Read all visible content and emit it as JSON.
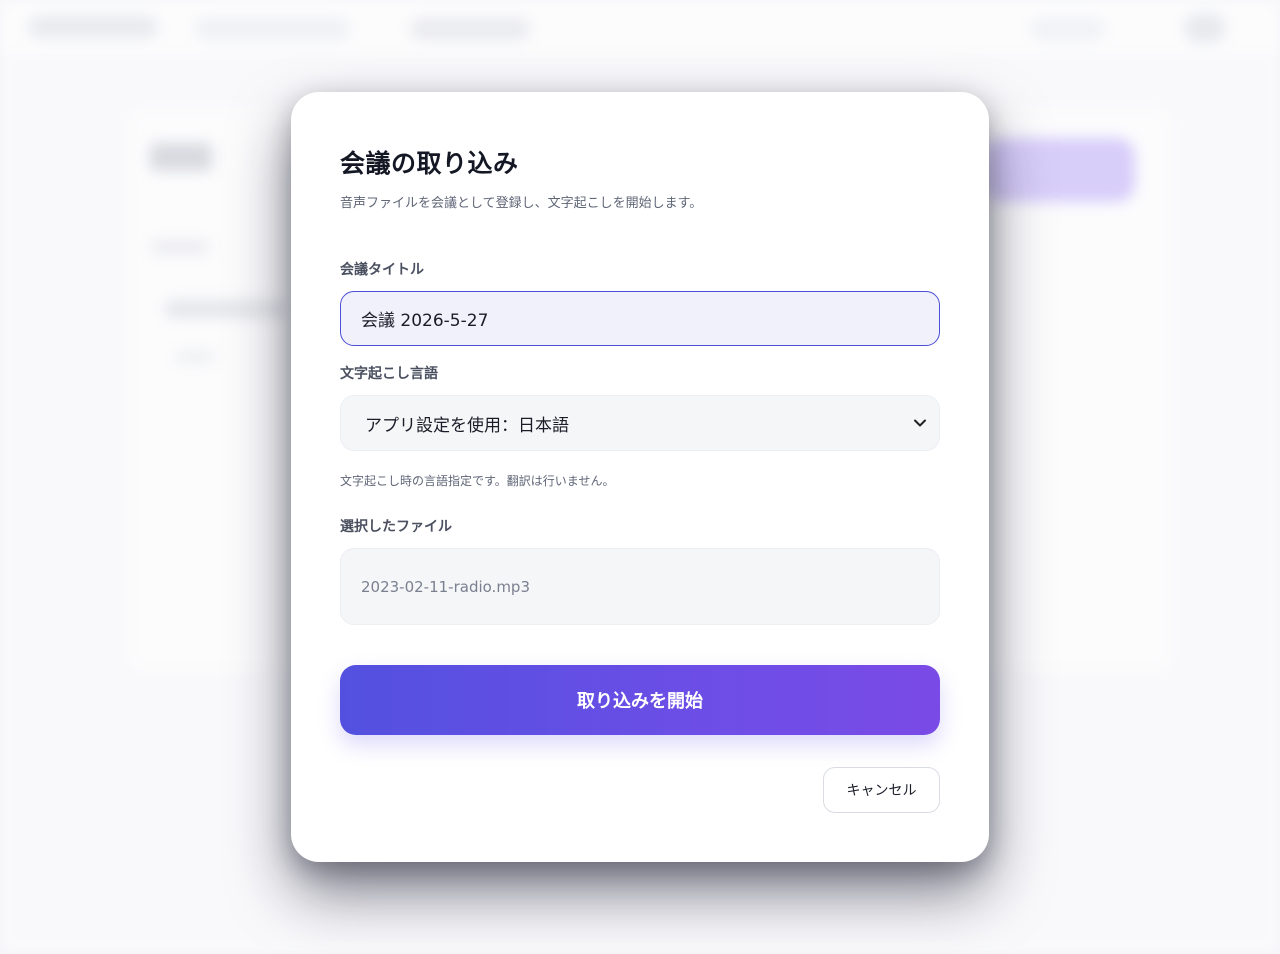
{
  "modal": {
    "title": "会議の取り込み",
    "subtitle": "音声ファイルを会議として登録し、文字起こしを開始します。",
    "title_field": {
      "label": "会議タイトル",
      "value": "会議 2026-5-27"
    },
    "language_field": {
      "label": "文字起こし言語",
      "selected": "アプリ設定を使用：日本語",
      "helper": "文字起こし時の言語指定です。翻訳は行いません。"
    },
    "file_field": {
      "label": "選択したファイル",
      "file_name": "2023-02-11-radio.mp3"
    },
    "start_button_label": "取り込みを開始",
    "cancel_button_label": "キャンセル"
  },
  "colors": {
    "accent_start": "#5350e0",
    "accent_end": "#7a4ae6",
    "input_border_focus": "#4c4fd8"
  },
  "icons": {
    "select_chevron": "chevron-down-icon"
  }
}
